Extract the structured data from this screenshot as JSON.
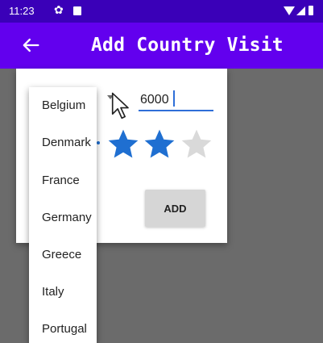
{
  "status_bar": {
    "time": "11:23",
    "icons": [
      "gear-icon",
      "sd-card-icon",
      "wifi-icon",
      "signal-icon",
      "battery-icon"
    ]
  },
  "app_bar": {
    "title": "Add Country Visit",
    "back_icon": "arrow-left-icon",
    "color": "#6200ee"
  },
  "form": {
    "amount_value": "6000",
    "rating": 2,
    "max_rating": 3,
    "star_filled_color": "#1f6fd1",
    "star_empty_color": "#d9d9d9",
    "add_label": "ADD"
  },
  "dropdown": {
    "items": [
      "Belgium",
      "Denmark",
      "France",
      "Germany",
      "Greece",
      "Italy",
      "Portugal"
    ]
  }
}
